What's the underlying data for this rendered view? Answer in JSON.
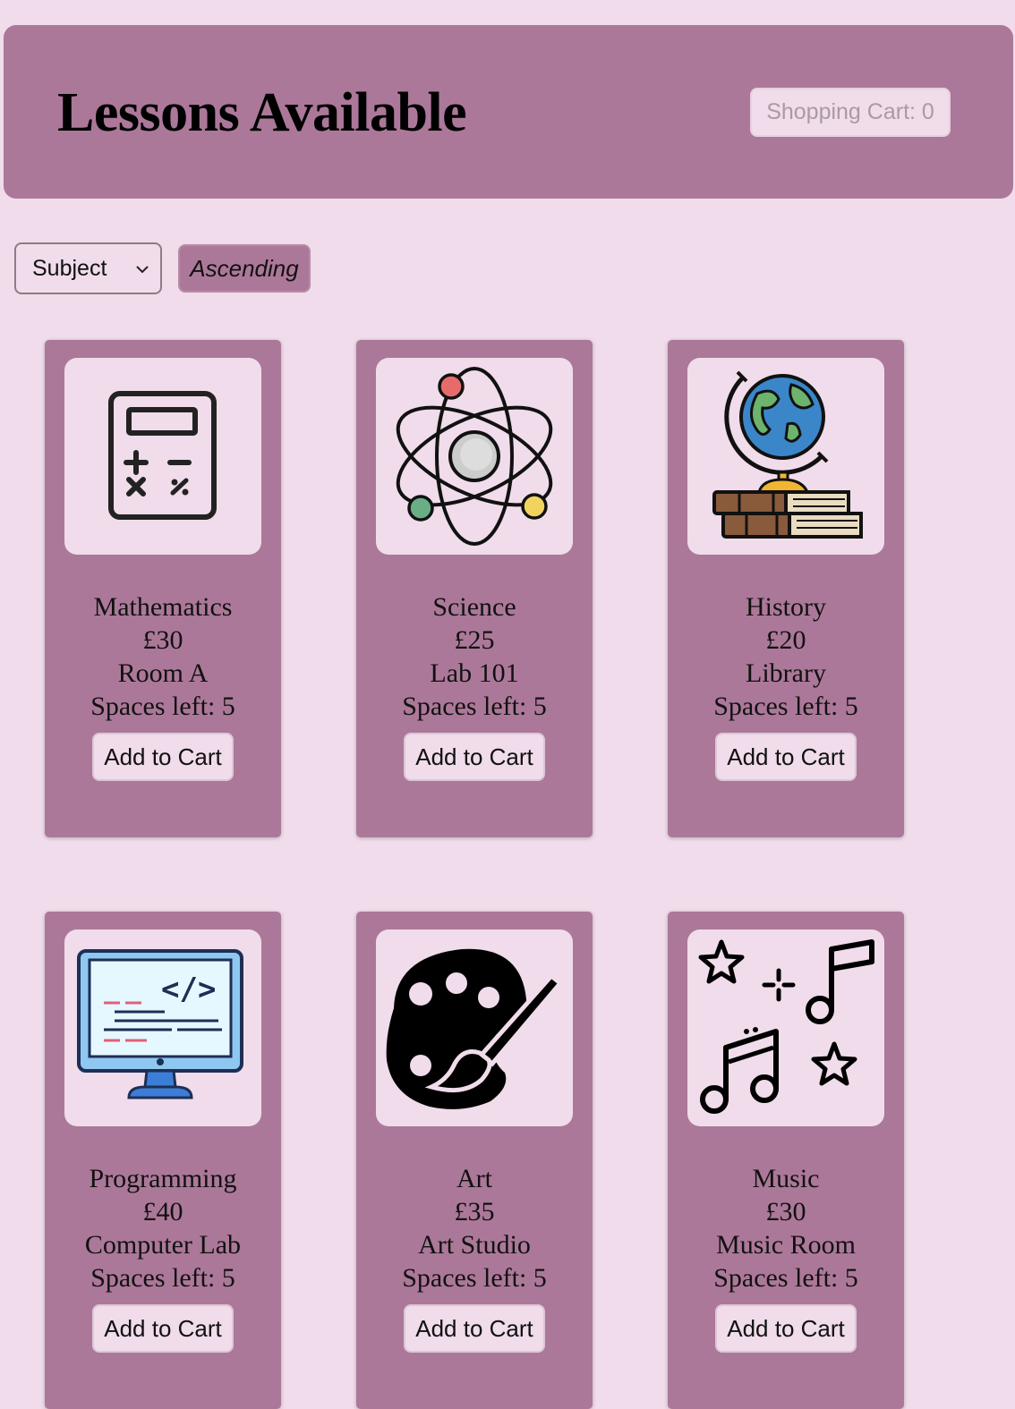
{
  "header": {
    "title": "Lessons Available",
    "cart_label": "Shopping Cart: 0"
  },
  "controls": {
    "sort_field": "Subject",
    "sort_order": "Ascending"
  },
  "lessons": [
    {
      "subject": "Mathematics",
      "price": "£30",
      "location": "Room A",
      "spaces": "Spaces left: 5",
      "button": "Add to Cart",
      "icon": "calculator-icon"
    },
    {
      "subject": "Science",
      "price": "£25",
      "location": "Lab 101",
      "spaces": "Spaces left: 5",
      "button": "Add to Cart",
      "icon": "atom-icon"
    },
    {
      "subject": "History",
      "price": "£20",
      "location": "Library",
      "spaces": "Spaces left: 5",
      "button": "Add to Cart",
      "icon": "globe-books-icon"
    },
    {
      "subject": "Programming",
      "price": "£40",
      "location": "Computer Lab",
      "spaces": "Spaces left: 5",
      "button": "Add to Cart",
      "icon": "code-monitor-icon"
    },
    {
      "subject": "Art",
      "price": "£35",
      "location": "Art Studio",
      "spaces": "Spaces left: 5",
      "button": "Add to Cart",
      "icon": "palette-icon"
    },
    {
      "subject": "Music",
      "price": "£30",
      "location": "Music Room",
      "spaces": "Spaces left: 5",
      "button": "Add to Cart",
      "icon": "music-notes-icon"
    }
  ],
  "colors": {
    "background": "#f0dcea",
    "accent": "#ac7899"
  }
}
